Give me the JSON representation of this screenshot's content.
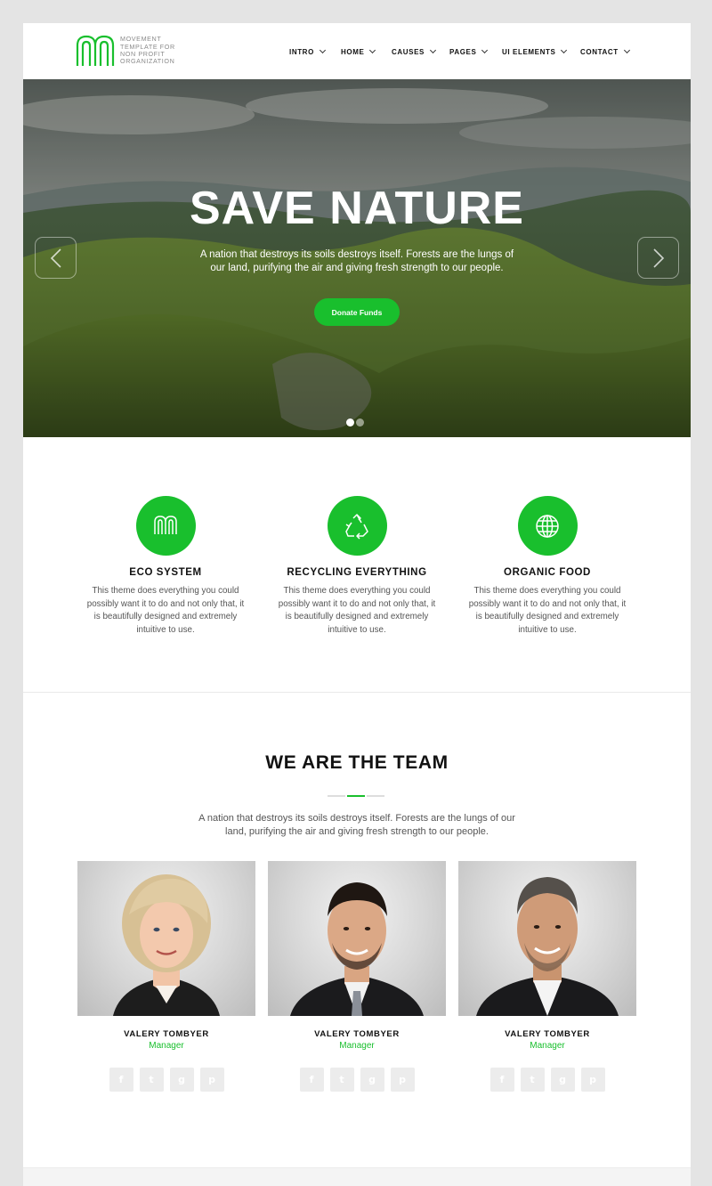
{
  "header": {
    "logo_text": "MOVEMENT TEMPLATE FOR NON PROFIT ORGANIZATION",
    "nav": [
      "INTRO",
      "HOME",
      "CAUSES",
      "PAGES",
      "UI ELEMENTS",
      "CONTACT"
    ]
  },
  "hero": {
    "title": "SAVE NATURE",
    "subtitle": "A nation that destroys its soils destroys itself. Forests are the lungs of our land, purifying the air and giving fresh strength to our people.",
    "button_label": "Donate Funds",
    "slides_total": 2,
    "active_slide": 1
  },
  "features": [
    {
      "title": "ECO SYSTEM",
      "text": "This theme does everything you could possibly want it to do and not only that, it is beautifully designed and extremely intuitive to use.",
      "icon": "logo-icon"
    },
    {
      "title": "RECYCLING EVERYTHING",
      "text": "This theme does everything you could possibly want it to do and not only that, it is beautifully designed and extremely intuitive to use.",
      "icon": "recycle-icon"
    },
    {
      "title": "ORGANIC FOOD",
      "text": "This theme does everything you could possibly want it to do and not only that, it is beautifully designed and extremely intuitive to use.",
      "icon": "globe-icon"
    }
  ],
  "team": {
    "title": "WE ARE THE TEAM",
    "subtitle": "A nation that destroys its soils destroys itself. Forests are the lungs of our land, purifying the air and giving fresh strength to our people.",
    "members": [
      {
        "name": "VALERY TOMBYER",
        "role": "Manager"
      },
      {
        "name": "VALERY TOMBYER",
        "role": "Manager"
      },
      {
        "name": "VALERY TOMBYER",
        "role": "Manager"
      }
    ],
    "social_icons": [
      "facebook-icon",
      "twitter-icon",
      "google-plus-icon",
      "pinterest-icon"
    ],
    "social_glyphs": [
      "f",
      "t",
      "g",
      "p"
    ]
  },
  "colors": {
    "accent": "#19bf2d",
    "page_bg": "#e4e4e4",
    "text_dark": "#111111",
    "text_muted": "#555555"
  }
}
